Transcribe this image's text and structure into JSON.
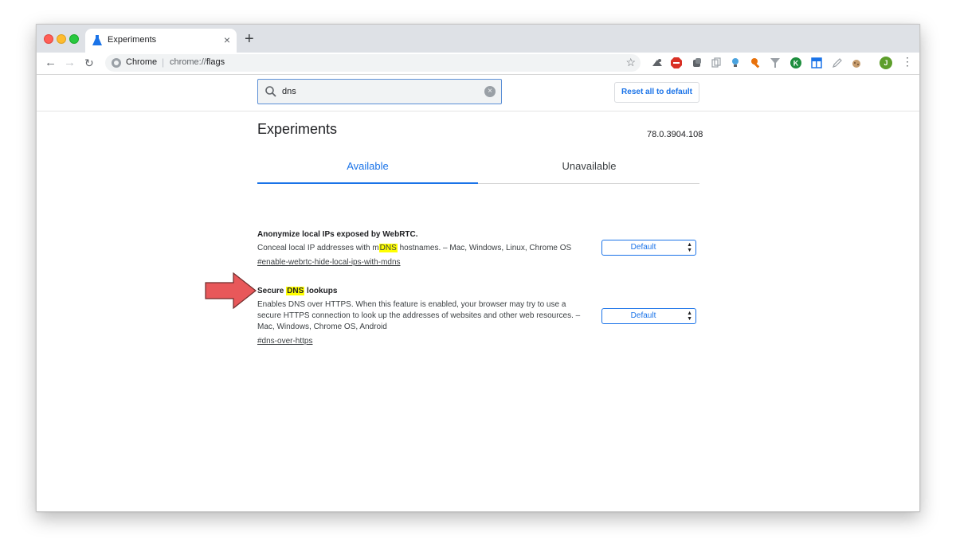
{
  "window": {
    "tab": {
      "title": "Experiments",
      "close_glyph": "×"
    },
    "newtab_glyph": "+",
    "nav": {
      "back_glyph": "←",
      "forward_glyph": "→",
      "reload_glyph": "↻"
    },
    "omnibox": {
      "site_label": "Chrome",
      "separator": "|",
      "url_scheme": "chrome://",
      "url_path": "flags",
      "bookmark_glyph": "☆"
    },
    "avatar_letter": "J",
    "menu_glyph": "⋮",
    "extension_icons": [
      "weather-icon",
      "adblock-plus-icon",
      "extension-box-icon",
      "copy-icon",
      "lightbulb-icon",
      "wrench-icon",
      "filter-icon",
      "k-circle-icon",
      "grid-app-icon",
      "pencil-icon",
      "cookie-icon"
    ]
  },
  "page": {
    "search": {
      "value": "dns",
      "clear_glyph": "×"
    },
    "reset_label": "Reset all to default",
    "title": "Experiments",
    "version": "78.0.3904.108",
    "tabs": [
      {
        "label": "Available",
        "active": true
      },
      {
        "label": "Unavailable",
        "active": false
      }
    ],
    "flags": [
      {
        "title_pre": "Anonymize local IPs exposed by WebRTC.",
        "title_mark": "",
        "title_post": "",
        "desc_pre": "Conceal local IP addresses with m",
        "desc_mark": "DNS",
        "desc_post": " hostnames. – Mac, Windows, Linux, Chrome OS",
        "link": "#enable-webrtc-hide-local-ips-with-mdns",
        "select_value": "Default"
      },
      {
        "title_pre": "Secure ",
        "title_mark": "DNS",
        "title_post": " lookups",
        "desc_pre": "Enables DNS over HTTPS. When this feature is enabled, your browser may try to use a secure HTTPS connection to look up the addresses of websites and other web resources. – Mac, Windows, Chrome OS, Android",
        "desc_mark": "",
        "desc_post": "",
        "link": "#dns-over-https",
        "select_value": "Default"
      }
    ],
    "select_arrows": "▲▼"
  },
  "colors": {
    "accent": "#1a73e8",
    "highlight": "#ffff00",
    "annotation_arrow": "#e8585a",
    "tabstrip": "#dee1e6"
  }
}
